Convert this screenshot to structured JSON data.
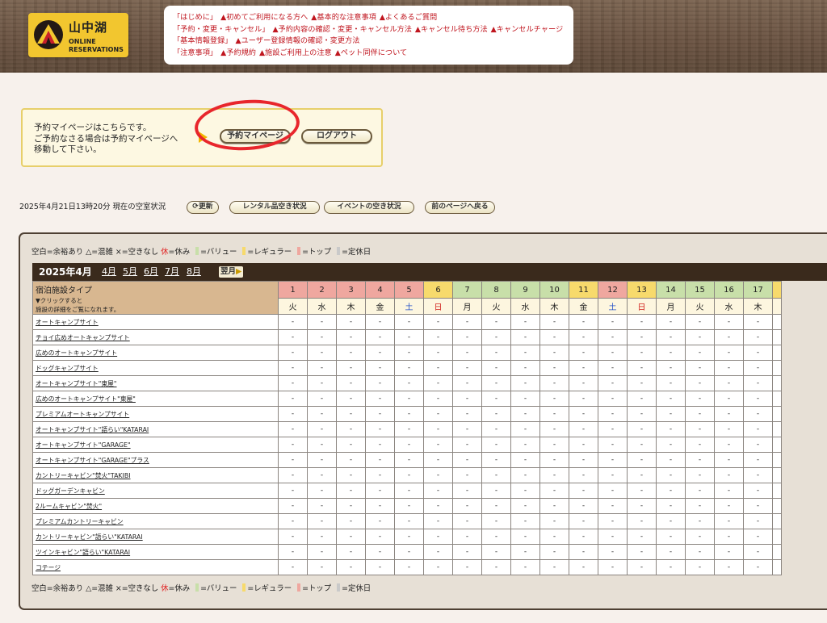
{
  "header": {
    "logo_title": "山中湖",
    "logo_sub1": "ONLINE",
    "logo_sub2": "RESERVATIONS",
    "nav": [
      [
        "「はじめに」",
        "▲初めてご利用になる方へ",
        "▲基本的な注意事項",
        "▲よくあるご質問"
      ],
      [
        "「予約・変更・キャンセル」",
        "▲予約内容の確認・変更・キャンセル方法",
        "▲キャンセル待ち方法",
        "▲キャンセルチャージ"
      ],
      [
        "「基本情報登録」",
        "▲ユーザー登録情報の確認・変更方法"
      ],
      [
        "「注意事項」",
        "▲予約規約",
        "▲施設ご利用上の注意",
        "▲ペット同伴について"
      ]
    ]
  },
  "info": {
    "line1": "予約マイページはこちらです。",
    "line2": "ご予約なさる場合は予約マイページへ",
    "line3": "移動して下さい。",
    "mypage_label": "予約マイページ",
    "logout_label": "ログアウト"
  },
  "status": {
    "text": "2025年4月21日13時20分  現在の空室状況",
    "refresh_label": "更新",
    "rental_label": "レンタル品空き状況",
    "event_label": "イベントの空き状況",
    "back_label": "前のページへ戻る"
  },
  "legend": {
    "part1": "空白=余裕あり △=混雑 ×=空きなし ",
    "kyu": "休",
    "part2": "=休み",
    "value": "=バリュー",
    "regular": "=レギュラー",
    "top": "=トップ",
    "closed": "=定休日",
    "colors": {
      "value": "#c8dfa9",
      "regular": "#f7da6c",
      "top": "#efa79f",
      "closed": "#c9c9c9"
    }
  },
  "calendar": {
    "current_month": "2025年4月",
    "month_links": [
      "4月",
      "5月",
      "6月",
      "7月",
      "8月"
    ],
    "next_label": "翌月",
    "type_header": "宿泊施設タイプ",
    "type_hint1": "▼クリックすると",
    "type_hint2": "施設の詳細をご覧になれます。",
    "days": [
      {
        "d": "1",
        "w": "火",
        "c": "red"
      },
      {
        "d": "2",
        "w": "水",
        "c": "red"
      },
      {
        "d": "3",
        "w": "木",
        "c": "red"
      },
      {
        "d": "4",
        "w": "金",
        "c": "red"
      },
      {
        "d": "5",
        "w": "土",
        "c": "red"
      },
      {
        "d": "6",
        "w": "日",
        "c": "yel"
      },
      {
        "d": "7",
        "w": "月",
        "c": "grn"
      },
      {
        "d": "8",
        "w": "火",
        "c": "grn"
      },
      {
        "d": "9",
        "w": "水",
        "c": "grn"
      },
      {
        "d": "10",
        "w": "木",
        "c": "grn"
      },
      {
        "d": "11",
        "w": "金",
        "c": "yel"
      },
      {
        "d": "12",
        "w": "土",
        "c": "red"
      },
      {
        "d": "13",
        "w": "日",
        "c": "yel"
      },
      {
        "d": "14",
        "w": "月",
        "c": "grn"
      },
      {
        "d": "15",
        "w": "火",
        "c": "grn"
      },
      {
        "d": "16",
        "w": "水",
        "c": "grn"
      },
      {
        "d": "17",
        "w": "木",
        "c": "grn"
      }
    ],
    "cell_value": "-",
    "facilities": [
      "オートキャンプサイト",
      "チョイ広めオートキャンプサイト",
      "広めのオートキャンプサイト",
      "ドッグキャンプサイト",
      "オートキャンプサイト\"東屋\"",
      "広めのオートキャンプサイト\"東屋\"",
      "プレミアムオートキャンプサイト",
      "オートキャンプサイト\"語らい\"KATARAI",
      "オートキャンプサイト\"GARAGE\"",
      "オートキャンプサイト\"GARAGE\"プラス",
      "カントリーキャビン\"焚火\"TAKIBI",
      "ドッグガーデンキャビン",
      "2ルームキャビン\"焚火\"",
      "プレミアムカントリーキャビン",
      "カントリーキャビン\"語らい\"KATARAI",
      "ツインキャビン\"語らい\"KATARAI",
      "コテージ"
    ]
  }
}
